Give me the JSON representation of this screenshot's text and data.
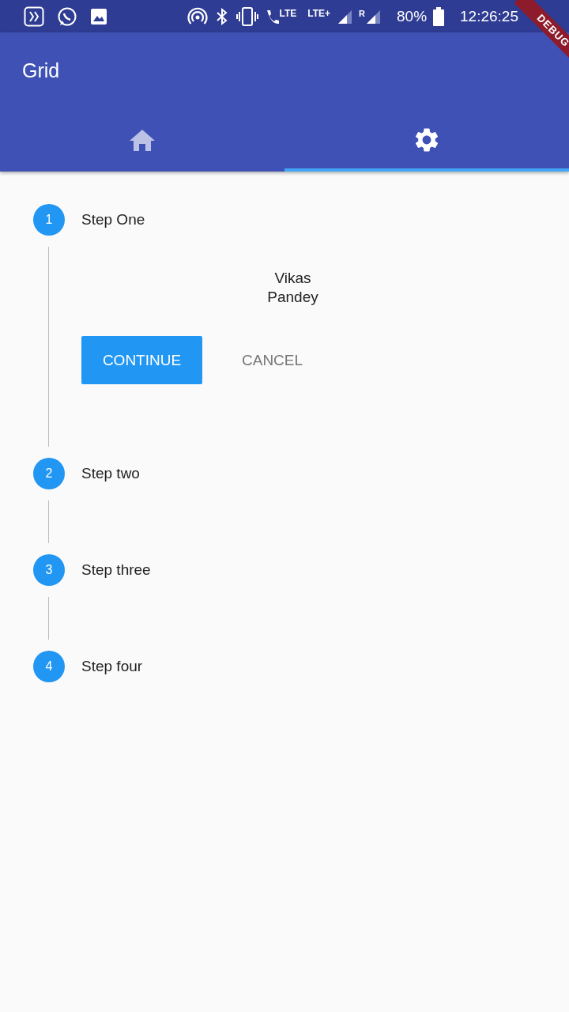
{
  "status_bar": {
    "network_labels": [
      "LTE",
      "LTE+",
      "R"
    ],
    "battery": "80%",
    "time": "12:26:25"
  },
  "debug_banner": "DEBUG",
  "app_bar": {
    "title": "Grid"
  },
  "tabs": [
    {
      "kind": "home",
      "selected": false
    },
    {
      "kind": "settings",
      "selected": true
    }
  ],
  "steps": [
    {
      "number": "1",
      "title": "Step One",
      "expanded": true,
      "content": [
        "Vikas",
        "Pandey"
      ],
      "continue_label": "CONTINUE",
      "cancel_label": "CANCEL"
    },
    {
      "number": "2",
      "title": "Step two",
      "expanded": false
    },
    {
      "number": "3",
      "title": "Step three",
      "expanded": false
    },
    {
      "number": "4",
      "title": "Step four",
      "expanded": false
    }
  ]
}
